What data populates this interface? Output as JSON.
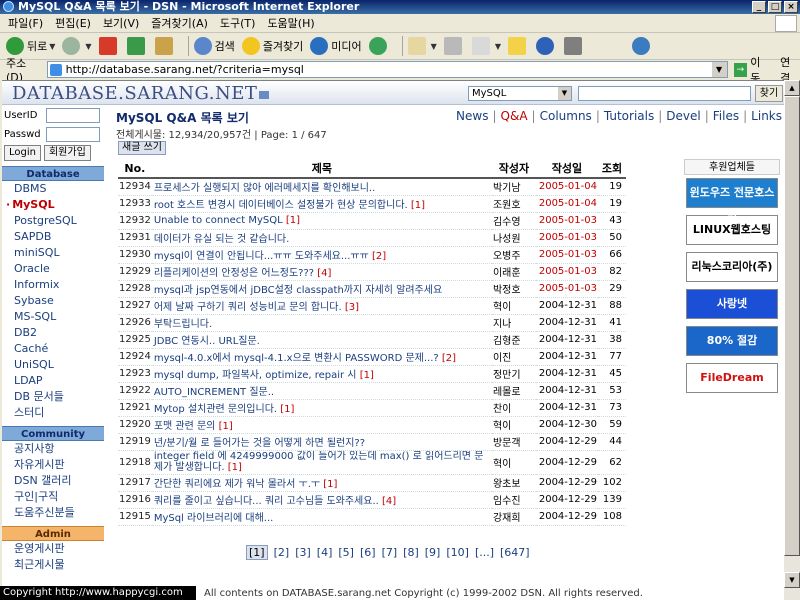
{
  "window": {
    "title": "MySQL Q&A 목록 보기 - DSN - Microsoft Internet Explorer"
  },
  "menubar": {
    "items": [
      "파일(F)",
      "편집(E)",
      "보기(V)",
      "즐겨찾기(A)",
      "도구(T)",
      "도움말(H)"
    ]
  },
  "toolbar": {
    "back": "뒤로",
    "search": "검색",
    "favorites": "즐겨찾기",
    "media": "미디어"
  },
  "address": {
    "label": "주소(D)",
    "url": "http://database.sarang.net/?criteria=mysql",
    "go": "이동",
    "links": "연결"
  },
  "site": {
    "logo": "DATABASE.SARANG.NET",
    "search_select": "MySQL",
    "search_button": "찾기"
  },
  "login": {
    "userid_label": "UserID",
    "password_label": "Passwd",
    "login_button": "Login",
    "join_button": "회원가입"
  },
  "sidebar": {
    "database_head": "Database",
    "database_items": [
      "DBMS",
      "MySQL",
      "PostgreSQL",
      "SAPDB",
      "miniSQL",
      "Oracle",
      "Informix",
      "Sybase",
      "MS-SQL",
      "DB2",
      "Caché",
      "UniSQL",
      "LDAP",
      "DB 문서들",
      "스터디"
    ],
    "community_head": "Community",
    "community_items": [
      "공지사항",
      "자유게시판",
      "DSN 갤러리",
      "구인|구직",
      "도움주신분들"
    ],
    "admin_head": "Admin",
    "admin_items": [
      "운영게시판",
      "최근게시물"
    ]
  },
  "board": {
    "title": "MySQL Q&A 목록 보기",
    "nav": [
      "News",
      "Q&A",
      "Columns",
      "Tutorials",
      "Devel",
      "Files",
      "Links"
    ],
    "count": "전체게시물: 12,934/20,957건 | Page: 1 / 647",
    "write_button": "새글 쓰기",
    "columns": [
      "No.",
      "제목",
      "작성자",
      "작성일",
      "조회"
    ],
    "rows": [
      {
        "no": "12934",
        "subject": "프로세스가 실행되지 않아 에러메세지를 확인해보니..",
        "comments": "",
        "author": "박기남",
        "date": "2005-01-04",
        "views": "19",
        "recent": true
      },
      {
        "no": "12933",
        "subject": "root 호스트 변경시 데이터베이스 설정불가 현상 문의합니다.",
        "comments": "[1]",
        "author": "조원호",
        "date": "2005-01-04",
        "views": "19",
        "recent": true
      },
      {
        "no": "12932",
        "subject": "Unable to connect MySQL",
        "comments": "[1]",
        "author": "김수영",
        "date": "2005-01-03",
        "views": "43",
        "recent": true
      },
      {
        "no": "12931",
        "subject": "데이터가 유실 되는 것 같습니다.",
        "comments": "",
        "author": "나성원",
        "date": "2005-01-03",
        "views": "50",
        "recent": true
      },
      {
        "no": "12930",
        "subject": "mysql이 연결이 안됩니다...ㅠㅠ 도와주세요...ㅠㅠ",
        "comments": "[2]",
        "author": "오병주",
        "date": "2005-01-03",
        "views": "66",
        "recent": true
      },
      {
        "no": "12929",
        "subject": "리플리케이션의 안정성은 어느정도???",
        "comments": "[4]",
        "author": "이래훈",
        "date": "2005-01-03",
        "views": "82",
        "recent": true
      },
      {
        "no": "12928",
        "subject": "mysql과 jsp연동에서 jDBC설정 classpath까지 자세히 알려주세요",
        "comments": "",
        "author": "박정호",
        "date": "2005-01-03",
        "views": "29",
        "recent": true
      },
      {
        "no": "12927",
        "subject": "어제 날짜 구하기 쿼리 성능비교 문의 합니다.",
        "comments": "[3]",
        "author": "혁이",
        "date": "2004-12-31",
        "views": "88",
        "recent": false
      },
      {
        "no": "12926",
        "subject": "부탁드립니다.",
        "comments": "",
        "author": "지나",
        "date": "2004-12-31",
        "views": "41",
        "recent": false
      },
      {
        "no": "12925",
        "subject": "JDBC 연동시.. URL질문.",
        "comments": "",
        "author": "김형준",
        "date": "2004-12-31",
        "views": "38",
        "recent": false
      },
      {
        "no": "12924",
        "subject": "mysql-4.0.x에서 mysql-4.1.x으로 변환시 PASSWORD 문제...?",
        "comments": "[2]",
        "author": "이진",
        "date": "2004-12-31",
        "views": "77",
        "recent": false
      },
      {
        "no": "12923",
        "subject": "mysql dump, 파일복사, optimize, repair 시",
        "comments": "[1]",
        "author": "정만기",
        "date": "2004-12-31",
        "views": "45",
        "recent": false
      },
      {
        "no": "12922",
        "subject": "AUTO_INCREMENT 질문..",
        "comments": "",
        "author": "레몰로",
        "date": "2004-12-31",
        "views": "53",
        "recent": false
      },
      {
        "no": "12921",
        "subject": "Mytop 설치관련 문의입니다.",
        "comments": "[1]",
        "author": "찬이",
        "date": "2004-12-31",
        "views": "73",
        "recent": false
      },
      {
        "no": "12920",
        "subject": "포맷 관련 문의",
        "comments": "[1]",
        "author": "혁이",
        "date": "2004-12-30",
        "views": "59",
        "recent": false
      },
      {
        "no": "12919",
        "subject": "년/분기/월 로 들어가는 것을 어떻게 하면 될런지??",
        "comments": "",
        "author": "방문객",
        "date": "2004-12-29",
        "views": "44",
        "recent": false
      },
      {
        "no": "12918",
        "subject": "integer field 에 4249999000 값이 들어가 있는데 max() 로 읽어드리면 문제가 발생합니다.",
        "comments": "[1]",
        "author": "혁이",
        "date": "2004-12-29",
        "views": "62",
        "recent": false,
        "tall": true
      },
      {
        "no": "12917",
        "subject": "간단한 쿼리에요 제가 워낙 몰라서 ㅜ.ㅜ",
        "comments": "[1]",
        "author": "왕초보",
        "date": "2004-12-29",
        "views": "102",
        "recent": false
      },
      {
        "no": "12916",
        "subject": "쿼리를 줄이고 싶습니다... 쿼리 고수님들 도와주세요..",
        "comments": "[4]",
        "author": "임수진",
        "date": "2004-12-29",
        "views": "139",
        "recent": false
      },
      {
        "no": "12915",
        "subject": "MySql 라이브러리에 대해...",
        "comments": "",
        "author": "강재희",
        "date": "2004-12-29",
        "views": "108",
        "recent": false
      }
    ],
    "pagination": [
      "[1]",
      "[2]",
      "[3]",
      "[4]",
      "[5]",
      "[6]",
      "[7]",
      "[8]",
      "[9]",
      "[10]",
      "[...]",
      "[647]"
    ]
  },
  "sponsors": {
    "head": "후원업체들",
    "items": [
      {
        "label": "윈도우즈 전문호스팅",
        "bg": "#1f7fcf",
        "fg": "#ffffff"
      },
      {
        "label": "LINUX웹호스팅",
        "bg": "#ffffff",
        "fg": "#000000"
      },
      {
        "label": "리눅스코리아(주)",
        "bg": "#ffffff",
        "fg": "#000000"
      },
      {
        "label": "사랑넷",
        "bg": "#1a4fd6",
        "fg": "#ffffff"
      },
      {
        "label": "80% 절감",
        "bg": "#1b66c9",
        "fg": "#ffffff"
      },
      {
        "label": "FileDream",
        "bg": "#ffffff",
        "fg": "#d01010"
      }
    ]
  },
  "footer": {
    "copyright": "Copyright   http://www.happycgi.com",
    "text": "All contents on DATABASE.sarang.net Copyright (c) 1999-2002 DSN. All rights reserved."
  },
  "colors": {
    "accent": "#1a3e7e",
    "recent_date": "#c00000",
    "sidebar_head": "#7fa9d8",
    "admin_head": "#f4b46a"
  }
}
